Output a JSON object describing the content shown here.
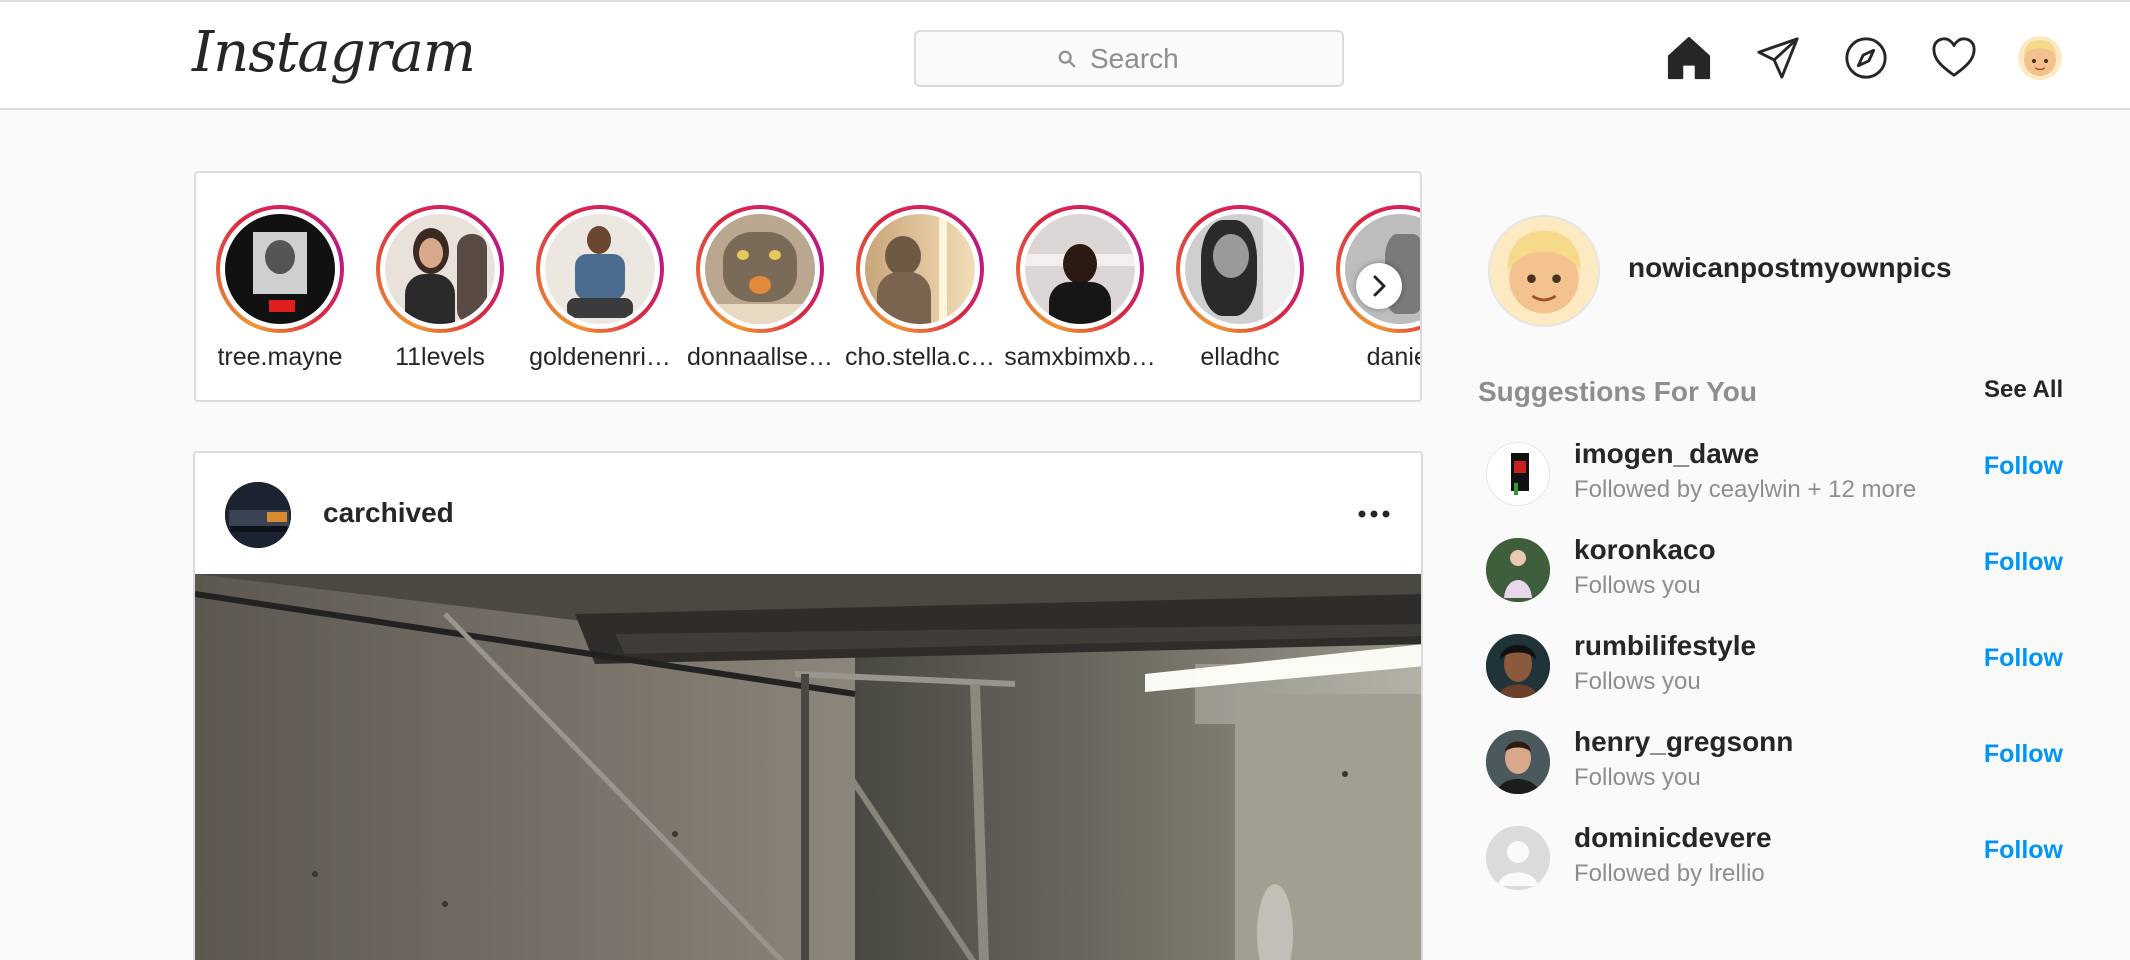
{
  "header": {
    "logo": "Instagram",
    "search_placeholder": "Search",
    "icons": [
      "home-icon",
      "direct-icon",
      "explore-icon",
      "activity-heart-icon",
      "profile-avatar"
    ]
  },
  "stories": [
    {
      "username": "tree.mayne"
    },
    {
      "username": "11levels"
    },
    {
      "username": "goldenenri…"
    },
    {
      "username": "donnaallse…"
    },
    {
      "username": "cho.stella.c…"
    },
    {
      "username": "samxbimxb…"
    },
    {
      "username": "elladhc"
    },
    {
      "username": "daniel"
    }
  ],
  "post": {
    "username": "carchived"
  },
  "sidebar": {
    "username": "nowicanpostmyownpics",
    "suggestions_title": "Suggestions For You",
    "see_all": "See All",
    "suggestions": [
      {
        "username": "imogen_dawe",
        "subtitle": "Followed by ceaylwin + 12 more",
        "action": "Follow"
      },
      {
        "username": "koronkaco",
        "subtitle": "Follows you",
        "action": "Follow"
      },
      {
        "username": "rumbilifestyle",
        "subtitle": "Follows you",
        "action": "Follow"
      },
      {
        "username": "henry_gregsonn",
        "subtitle": "Follows you",
        "action": "Follow"
      },
      {
        "username": "dominicdevere",
        "subtitle": "Followed by lrellio",
        "action": "Follow"
      }
    ]
  },
  "colors": {
    "accent": "#0095f6",
    "border": "#dbdbdb",
    "background": "#fafafa",
    "muted": "#8e8e8e"
  }
}
